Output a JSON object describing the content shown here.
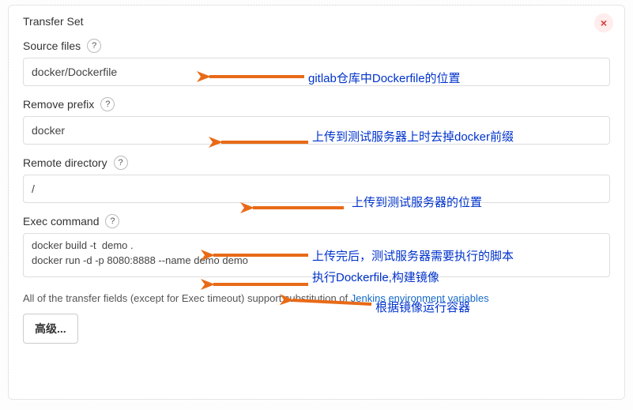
{
  "panel": {
    "title": "Transfer Set",
    "close_glyph": "×"
  },
  "fields": {
    "source_files": {
      "label": "Source files",
      "value": "docker/Dockerfile"
    },
    "remove_prefix": {
      "label": "Remove prefix",
      "value": "docker"
    },
    "remote_directory": {
      "label": "Remote directory",
      "value": "/"
    },
    "exec_command": {
      "label": "Exec command",
      "value": "docker build -t  demo .\ndocker run -d -p 8080:8888 --name demo demo"
    }
  },
  "help_glyph": "?",
  "footnote": {
    "prefix": "All of the transfer fields (except for Exec timeout) support substitution of ",
    "link_text": "Jenkins environment variables"
  },
  "advanced_label": "高级...",
  "annotations": {
    "a1": "gitlab仓库中Dockerfile的位置",
    "a2": "上传到测试服务器上时去掉docker前缀",
    "a3": "上传到测试服务器的位置",
    "a4": "上传完后，测试服务器需要执行的脚本",
    "a5": "执行Dockerfile,构建镜像",
    "a6": "根据镜像运行容器"
  },
  "colors": {
    "annotation_blue": "#0033cc",
    "close_red": "#d33b3b",
    "arrow_orange": "#e86a17",
    "link_blue": "#1569c7"
  }
}
